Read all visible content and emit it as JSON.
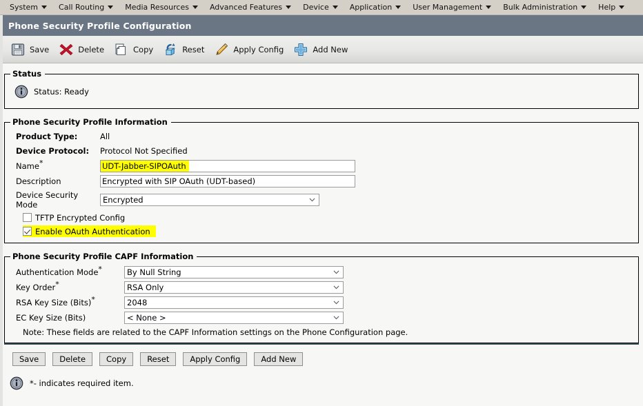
{
  "menubar": {
    "items": [
      {
        "label": "System",
        "icon": "chevron-down-icon"
      },
      {
        "label": "Call Routing",
        "icon": "chevron-down-icon"
      },
      {
        "label": "Media Resources",
        "icon": "chevron-down-icon"
      },
      {
        "label": "Advanced Features",
        "icon": "chevron-down-icon"
      },
      {
        "label": "Device",
        "icon": "chevron-down-icon"
      },
      {
        "label": "Application",
        "icon": "chevron-down-icon"
      },
      {
        "label": "User Management",
        "icon": "chevron-down-icon"
      },
      {
        "label": "Bulk Administration",
        "icon": "chevron-down-icon"
      },
      {
        "label": "Help",
        "icon": "chevron-down-icon"
      }
    ]
  },
  "header": {
    "title": "Phone Security Profile Configuration",
    "bar_color": "#6b7685"
  },
  "toolbar": {
    "items": [
      {
        "label": "Save",
        "icon": "floppy-disk-icon"
      },
      {
        "label": "Delete",
        "icon": "red-x-icon"
      },
      {
        "label": "Copy",
        "icon": "copy-pages-icon"
      },
      {
        "label": "Reset",
        "icon": "reset-cube-icon"
      },
      {
        "label": "Apply Config",
        "icon": "pencil-icon"
      },
      {
        "label": "Add New",
        "icon": "blue-plus-icon"
      }
    ]
  },
  "status_panel": {
    "legend": "Status",
    "icon": "info-icon",
    "message": "Status: Ready"
  },
  "profile_panel": {
    "legend": "Phone Security Profile Information",
    "product_type_label": "Product Type:",
    "product_type_value": "All",
    "device_protocol_label": "Device Protocol:",
    "device_protocol_value": "Protocol Not Specified",
    "name_label": "Name",
    "name_required_mark": "*",
    "name_value": "UDT-Jabber-SIPOAuth",
    "name_highlight_color": "#ffff00",
    "description_label": "Description",
    "description_value": "Encrypted with SIP OAuth (UDT-based)",
    "device_security_mode_label": "Device Security Mode",
    "device_security_mode_value": "Encrypted",
    "tftp_encrypted_config_label": "TFTP Encrypted Config",
    "tftp_encrypted_config_checked": false,
    "enable_oauth_label": "Enable OAuth Authentication",
    "enable_oauth_checked": true,
    "enable_oauth_highlight_color": "#ffff00"
  },
  "capf_panel": {
    "legend": "Phone Security Profile CAPF Information",
    "rows": [
      {
        "label": "Authentication Mode",
        "required": "*",
        "value": "By Null String"
      },
      {
        "label": "Key Order",
        "required": "*",
        "value": "RSA Only"
      },
      {
        "label": "RSA Key Size (Bits)",
        "required": "*",
        "value": "2048"
      },
      {
        "label": "EC Key Size (Bits)",
        "required": "",
        "value": "< None >"
      }
    ],
    "note": "Note: These fields are related to the CAPF Information settings on the Phone Configuration page."
  },
  "footer": {
    "separator_color": "#37505c",
    "buttons": [
      {
        "label": "Save"
      },
      {
        "label": "Delete"
      },
      {
        "label": "Copy"
      },
      {
        "label": "Reset"
      },
      {
        "label": "Apply Config"
      },
      {
        "label": "Add New"
      }
    ],
    "icon": "info-icon",
    "required_note": "*- indicates required item."
  }
}
